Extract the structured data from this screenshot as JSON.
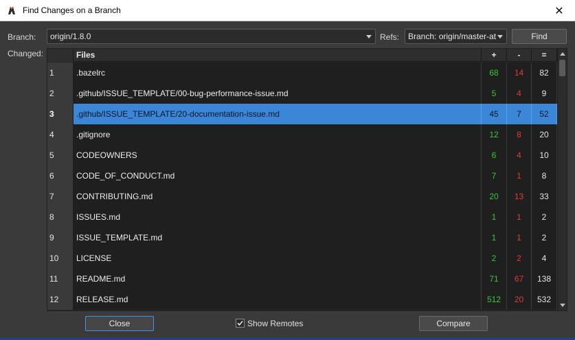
{
  "window": {
    "title": "Find Changes on a Branch",
    "close_glyph": "✕"
  },
  "filters": {
    "branch_label": "Branch:",
    "branch_value": "origin/1.8.0",
    "refs_label": "Refs:",
    "refs_value": "Branch: origin/master-at-a",
    "find_button": "Find",
    "changed_label": "Changed:"
  },
  "table": {
    "headers": {
      "files": "Files",
      "plus": "+",
      "minus": "-",
      "eq": "="
    },
    "selected_index": 2,
    "rows": [
      {
        "num": "1",
        "file": ".bazelrc",
        "plus": "68",
        "minus": "14",
        "eq": "82"
      },
      {
        "num": "2",
        "file": ".github/ISSUE_TEMPLATE/00-bug-performance-issue.md",
        "plus": "5",
        "minus": "4",
        "eq": "9"
      },
      {
        "num": "3",
        "file": ".github/ISSUE_TEMPLATE/20-documentation-issue.md",
        "plus": "45",
        "minus": "7",
        "eq": "52"
      },
      {
        "num": "4",
        "file": ".gitignore",
        "plus": "12",
        "minus": "8",
        "eq": "20"
      },
      {
        "num": "5",
        "file": "CODEOWNERS",
        "plus": "6",
        "minus": "4",
        "eq": "10"
      },
      {
        "num": "6",
        "file": "CODE_OF_CONDUCT.md",
        "plus": "7",
        "minus": "1",
        "eq": "8"
      },
      {
        "num": "7",
        "file": "CONTRIBUTING.md",
        "plus": "20",
        "minus": "13",
        "eq": "33"
      },
      {
        "num": "8",
        "file": "ISSUES.md",
        "plus": "1",
        "minus": "1",
        "eq": "2"
      },
      {
        "num": "9",
        "file": "ISSUE_TEMPLATE.md",
        "plus": "1",
        "minus": "1",
        "eq": "2"
      },
      {
        "num": "10",
        "file": "LICENSE",
        "plus": "2",
        "minus": "2",
        "eq": "4"
      },
      {
        "num": "11",
        "file": "README.md",
        "plus": "71",
        "minus": "67",
        "eq": "138"
      },
      {
        "num": "12",
        "file": "RELEASE.md",
        "plus": "512",
        "minus": "20",
        "eq": "532"
      }
    ]
  },
  "footer": {
    "close_button": "Close",
    "show_remotes_label": "Show Remotes",
    "show_remotes_checked": true,
    "compare_button": "Compare"
  },
  "colors": {
    "selection": "#3b86d6",
    "plus": "#36c936",
    "minus": "#e23a3a",
    "background": "#3a3a3a"
  }
}
